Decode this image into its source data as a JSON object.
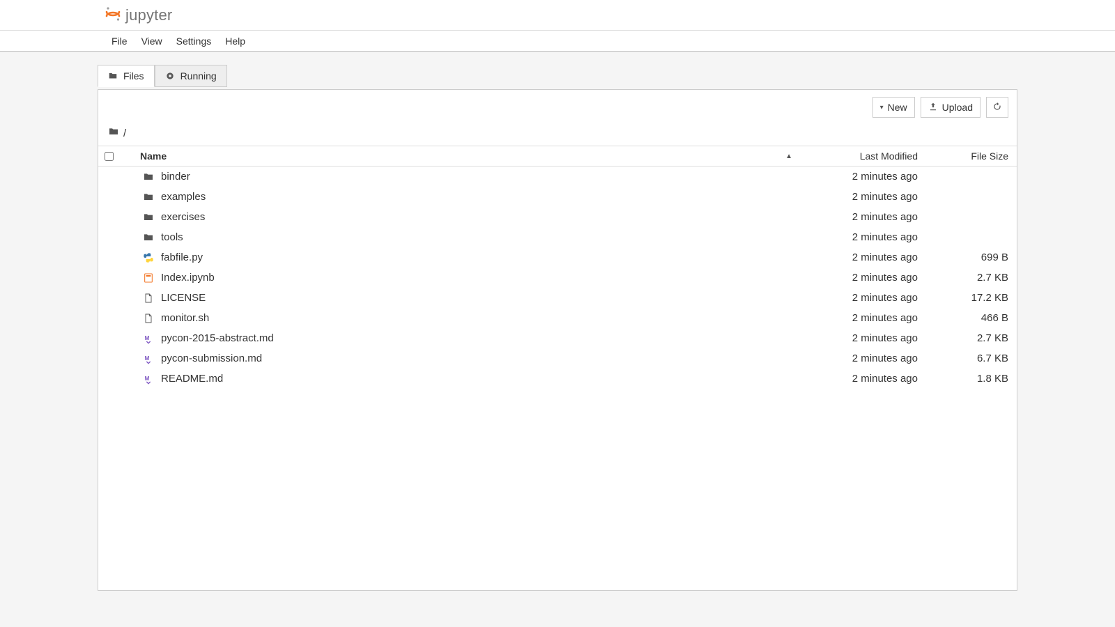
{
  "logo_text": "jupyter",
  "menu": {
    "items": [
      "File",
      "View",
      "Settings",
      "Help"
    ]
  },
  "tabs": {
    "files": {
      "label": "Files",
      "active": true
    },
    "running": {
      "label": "Running",
      "active": false
    }
  },
  "toolbar": {
    "new_label": "New",
    "upload_label": "Upload"
  },
  "breadcrumb": {
    "path": "/"
  },
  "columns": {
    "name": "Name",
    "last_modified": "Last Modified",
    "file_size": "File Size"
  },
  "rows": [
    {
      "type": "folder",
      "name": "binder",
      "modified": "2 minutes ago",
      "size": ""
    },
    {
      "type": "folder",
      "name": "examples",
      "modified": "2 minutes ago",
      "size": ""
    },
    {
      "type": "folder",
      "name": "exercises",
      "modified": "2 minutes ago",
      "size": ""
    },
    {
      "type": "folder",
      "name": "tools",
      "modified": "2 minutes ago",
      "size": ""
    },
    {
      "type": "python",
      "name": "fabfile.py",
      "modified": "2 minutes ago",
      "size": "699 B"
    },
    {
      "type": "notebook",
      "name": "Index.ipynb",
      "modified": "2 minutes ago",
      "size": "2.7 KB"
    },
    {
      "type": "file",
      "name": "LICENSE",
      "modified": "2 minutes ago",
      "size": "17.2 KB"
    },
    {
      "type": "file",
      "name": "monitor.sh",
      "modified": "2 minutes ago",
      "size": "466 B"
    },
    {
      "type": "markdown",
      "name": "pycon-2015-abstract.md",
      "modified": "2 minutes ago",
      "size": "2.7 KB"
    },
    {
      "type": "markdown",
      "name": "pycon-submission.md",
      "modified": "2 minutes ago",
      "size": "6.7 KB"
    },
    {
      "type": "markdown",
      "name": "README.md",
      "modified": "2 minutes ago",
      "size": "1.8 KB"
    }
  ]
}
